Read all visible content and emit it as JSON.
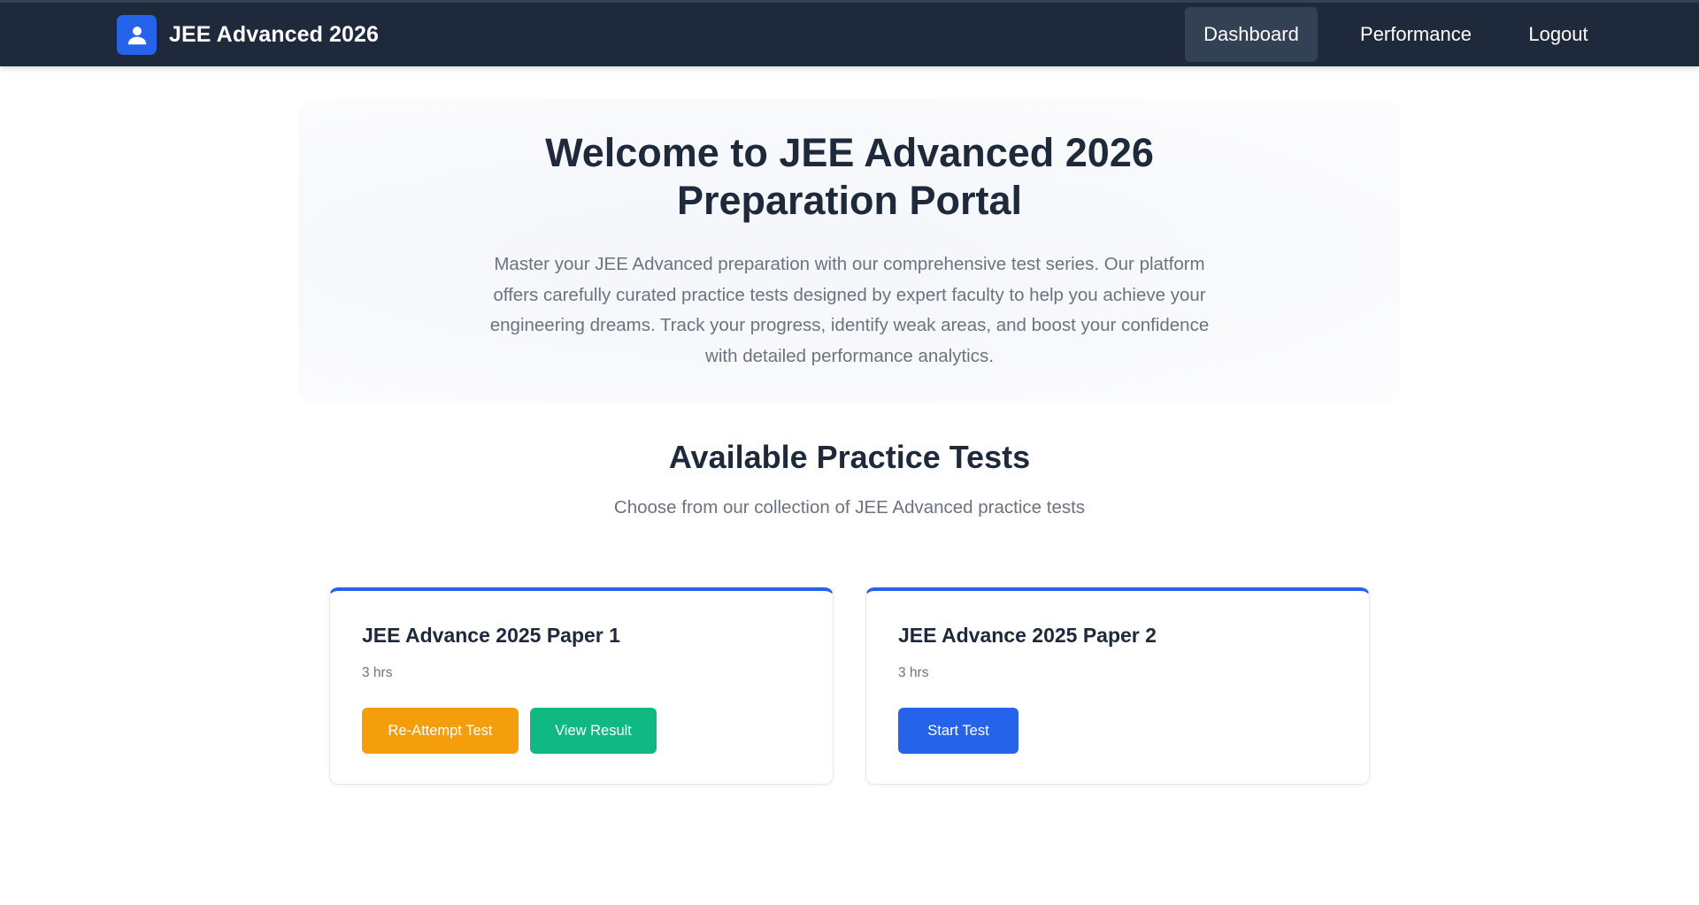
{
  "colors": {
    "navbar_bg": "#1e293b",
    "accent": "#2563eb",
    "warning": "#f59e0b",
    "success": "#10b981"
  },
  "header": {
    "brand_icon": "user-icon",
    "brand_title": "JEE Advanced 2026",
    "nav": {
      "dashboard": "Dashboard",
      "performance": "Performance",
      "logout": "Logout"
    },
    "active_nav": "Dashboard"
  },
  "hero": {
    "title_line1": "Welcome to JEE Advanced 2026",
    "title_line2": "Preparation Portal",
    "description": "Master your JEE Advanced preparation with our comprehensive test series. Our platform offers carefully curated practice tests designed by expert faculty to help you achieve your engineering dreams. Track your progress, identify weak areas, and boost your confidence with detailed performance analytics."
  },
  "tests_section": {
    "title": "Available Practice Tests",
    "subtitle": "Choose from our collection of JEE Advanced practice tests"
  },
  "tests": [
    {
      "title": "JEE Advance 2025 Paper 1",
      "duration": "3 hrs",
      "reattempt_label": "Re-Attempt Test",
      "result_label": "View Result"
    },
    {
      "title": "JEE Advance 2025 Paper 2",
      "duration": "3 hrs",
      "start_label": "Start Test"
    }
  ]
}
